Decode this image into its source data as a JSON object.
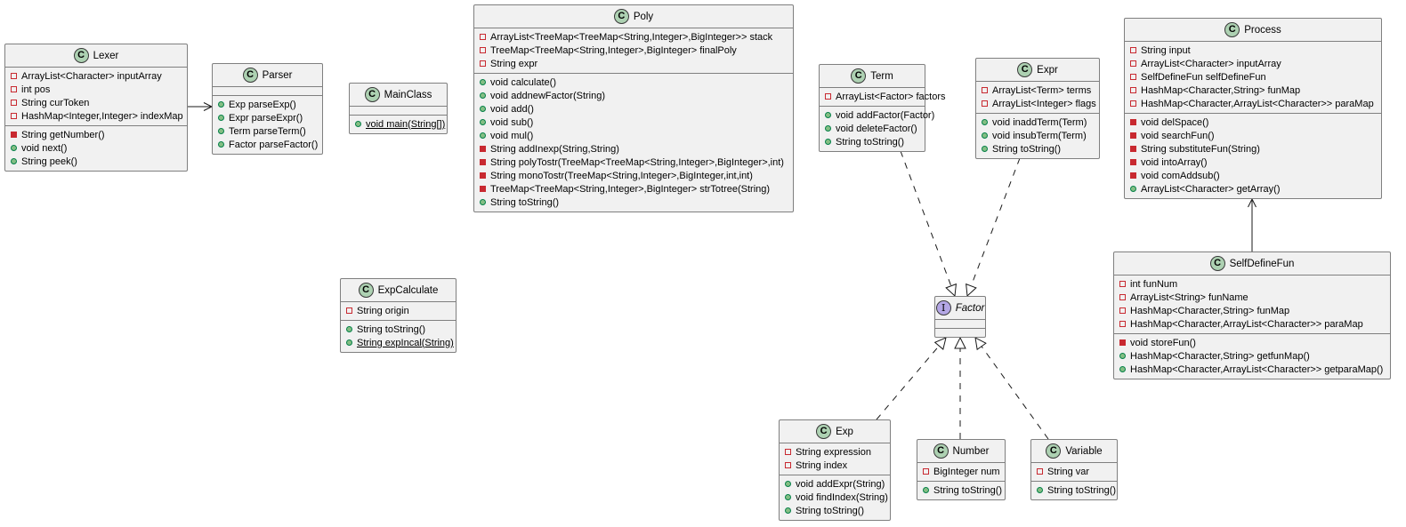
{
  "diagram_type": "UML class diagram",
  "classes": {
    "lexer": {
      "name": "Lexer",
      "kind": "class",
      "fields": [
        {
          "vis": "private",
          "text": "ArrayList<Character> inputArray"
        },
        {
          "vis": "private",
          "text": "int pos"
        },
        {
          "vis": "private",
          "text": "String curToken"
        },
        {
          "vis": "private",
          "text": "HashMap<Integer,Integer> indexMap"
        }
      ],
      "methods": [
        {
          "vis": "private",
          "text": "String getNumber()"
        },
        {
          "vis": "public",
          "text": "void next()"
        },
        {
          "vis": "public",
          "text": "String peek()"
        }
      ]
    },
    "parser": {
      "name": "Parser",
      "kind": "class",
      "fields": [],
      "methods": [
        {
          "vis": "public",
          "text": "Exp parseExp()"
        },
        {
          "vis": "public",
          "text": "Expr parseExpr()"
        },
        {
          "vis": "public",
          "text": "Term parseTerm()"
        },
        {
          "vis": "public",
          "text": "Factor parseFactor()"
        }
      ]
    },
    "mainclass": {
      "name": "MainClass",
      "kind": "class",
      "fields": [],
      "methods": [
        {
          "vis": "public",
          "text": "void main(String[])",
          "static": true
        }
      ]
    },
    "poly": {
      "name": "Poly",
      "kind": "class",
      "fields": [
        {
          "vis": "private",
          "text": "ArrayList<TreeMap<TreeMap<String,Integer>,BigInteger>> stack"
        },
        {
          "vis": "private",
          "text": "TreeMap<TreeMap<String,Integer>,BigInteger> finalPoly"
        },
        {
          "vis": "private",
          "text": "String expr"
        }
      ],
      "methods": [
        {
          "vis": "public",
          "text": "void calculate()"
        },
        {
          "vis": "public",
          "text": "void addnewFactor(String)"
        },
        {
          "vis": "public",
          "text": "void add()"
        },
        {
          "vis": "public",
          "text": "void sub()"
        },
        {
          "vis": "public",
          "text": "void mul()"
        },
        {
          "vis": "private",
          "text": "String addInexp(String,String)"
        },
        {
          "vis": "private",
          "text": "String polyTostr(TreeMap<TreeMap<String,Integer>,BigInteger>,int)"
        },
        {
          "vis": "private",
          "text": "String monoTostr(TreeMap<String,Integer>,BigInteger,int,int)"
        },
        {
          "vis": "private",
          "text": "TreeMap<TreeMap<String,Integer>,BigInteger> strTotree(String)"
        },
        {
          "vis": "public",
          "text": "String toString()"
        }
      ]
    },
    "expcalculate": {
      "name": "ExpCalculate",
      "kind": "class",
      "fields": [
        {
          "vis": "private",
          "text": "String origin"
        }
      ],
      "methods": [
        {
          "vis": "public",
          "text": "String toString()"
        },
        {
          "vis": "public",
          "text": "String expIncal(String)",
          "static": true
        }
      ]
    },
    "term": {
      "name": "Term",
      "kind": "class",
      "fields": [
        {
          "vis": "private",
          "text": "ArrayList<Factor> factors"
        }
      ],
      "methods": [
        {
          "vis": "public",
          "text": "void addFactor(Factor)"
        },
        {
          "vis": "public",
          "text": "void deleteFactor()"
        },
        {
          "vis": "public",
          "text": "String toString()"
        }
      ]
    },
    "expr": {
      "name": "Expr",
      "kind": "class",
      "fields": [
        {
          "vis": "private",
          "text": "ArrayList<Term> terms"
        },
        {
          "vis": "private",
          "text": "ArrayList<Integer> flags"
        }
      ],
      "methods": [
        {
          "vis": "public",
          "text": "void inaddTerm(Term)"
        },
        {
          "vis": "public",
          "text": "void insubTerm(Term)"
        },
        {
          "vis": "public",
          "text": "String toString()"
        }
      ]
    },
    "process": {
      "name": "Process",
      "kind": "class",
      "fields": [
        {
          "vis": "private",
          "text": "String input"
        },
        {
          "vis": "private",
          "text": "ArrayList<Character> inputArray"
        },
        {
          "vis": "private",
          "text": "SelfDefineFun selfDefineFun"
        },
        {
          "vis": "private",
          "text": "HashMap<Character,String> funMap"
        },
        {
          "vis": "private",
          "text": "HashMap<Character,ArrayList<Character>> paraMap"
        }
      ],
      "methods": [
        {
          "vis": "private",
          "text": "void delSpace()"
        },
        {
          "vis": "private",
          "text": "void searchFun()"
        },
        {
          "vis": "private",
          "text": "String substituteFun(String)"
        },
        {
          "vis": "private",
          "text": "void intoArray()"
        },
        {
          "vis": "private",
          "text": "void comAddsub()"
        },
        {
          "vis": "public",
          "text": "ArrayList<Character> getArray()"
        }
      ]
    },
    "selfdefinefun": {
      "name": "SelfDefineFun",
      "kind": "class",
      "fields": [
        {
          "vis": "private",
          "text": "int funNum"
        },
        {
          "vis": "private",
          "text": "ArrayList<String> funName"
        },
        {
          "vis": "private",
          "text": "HashMap<Character,String> funMap"
        },
        {
          "vis": "private",
          "text": "HashMap<Character,ArrayList<Character>> paraMap"
        }
      ],
      "methods": [
        {
          "vis": "private",
          "text": "void storeFun()"
        },
        {
          "vis": "public",
          "text": "HashMap<Character,String> getfunMap()"
        },
        {
          "vis": "public",
          "text": "HashMap<Character,ArrayList<Character>> getparaMap()"
        }
      ]
    },
    "factor": {
      "name": "Factor",
      "kind": "interface",
      "fields": [],
      "methods": []
    },
    "exp": {
      "name": "Exp",
      "kind": "class",
      "fields": [
        {
          "vis": "private",
          "text": "String expression"
        },
        {
          "vis": "private",
          "text": "String index"
        }
      ],
      "methods": [
        {
          "vis": "public",
          "text": "void addExpr(String)"
        },
        {
          "vis": "public",
          "text": "void findIndex(String)"
        },
        {
          "vis": "public",
          "text": "String toString()"
        }
      ]
    },
    "number": {
      "name": "Number",
      "kind": "class",
      "fields": [
        {
          "vis": "private",
          "text": "BigInteger num"
        }
      ],
      "methods": [
        {
          "vis": "public",
          "text": "String toString()"
        }
      ]
    },
    "variable": {
      "name": "Variable",
      "kind": "class",
      "fields": [
        {
          "vis": "private",
          "text": "String var"
        }
      ],
      "methods": [
        {
          "vis": "public",
          "text": "String toString()"
        }
      ]
    }
  },
  "relations": [
    {
      "from": "lexer",
      "to": "parser",
      "type": "association",
      "arrow": "open"
    },
    {
      "from": "selfdefinefun",
      "to": "process",
      "type": "association",
      "arrow": "open"
    },
    {
      "from": "term",
      "to": "factor",
      "type": "realization"
    },
    {
      "from": "expr",
      "to": "factor",
      "type": "realization"
    },
    {
      "from": "exp",
      "to": "factor",
      "type": "realization"
    },
    {
      "from": "number",
      "to": "factor",
      "type": "realization"
    },
    {
      "from": "variable",
      "to": "factor",
      "type": "realization"
    }
  ],
  "colors": {
    "class_fill": "#f1f1f1",
    "border": "#7f7f7f",
    "class_badge": "#add1b2",
    "interface_badge": "#b4a7e5",
    "private_marker": "#c82930",
    "public_marker": "#84be84"
  }
}
